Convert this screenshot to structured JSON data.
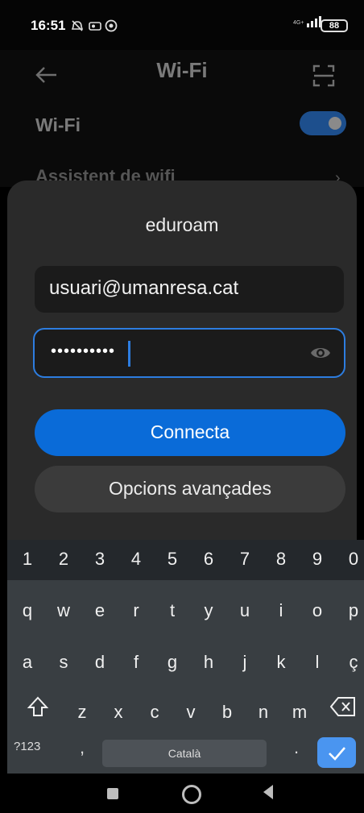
{
  "status_bar": {
    "time": "16:51",
    "battery": "88",
    "network": "4G+"
  },
  "settings": {
    "title": "Wi-Fi",
    "wifi_label": "Wi-Fi",
    "wifi_enabled": true,
    "assistant_label": "Assistent de wifi"
  },
  "dialog": {
    "title": "eduroam",
    "username": "usuari@umanresa.cat",
    "password_masked": "••••••••••",
    "connect_label": "Connecta",
    "advanced_label": "Opcions avançades"
  },
  "keyboard": {
    "numbers": [
      "1",
      "2",
      "3",
      "4",
      "5",
      "6",
      "7",
      "8",
      "9",
      "0"
    ],
    "row1": [
      "q",
      "w",
      "e",
      "r",
      "t",
      "y",
      "u",
      "i",
      "o",
      "p"
    ],
    "row2": [
      "a",
      "s",
      "d",
      "f",
      "g",
      "h",
      "j",
      "k",
      "l",
      "ç"
    ],
    "row3": [
      "z",
      "x",
      "c",
      "v",
      "b",
      "n",
      "m"
    ],
    "symbols_label": "?123",
    "comma": ",",
    "period": ".",
    "space_label": "Català"
  },
  "colors": {
    "accent": "#0a6bd8",
    "focus_border": "#2d7de0",
    "dialog_bg": "#2a2a2a",
    "keyboard_bg": "#393e42"
  }
}
